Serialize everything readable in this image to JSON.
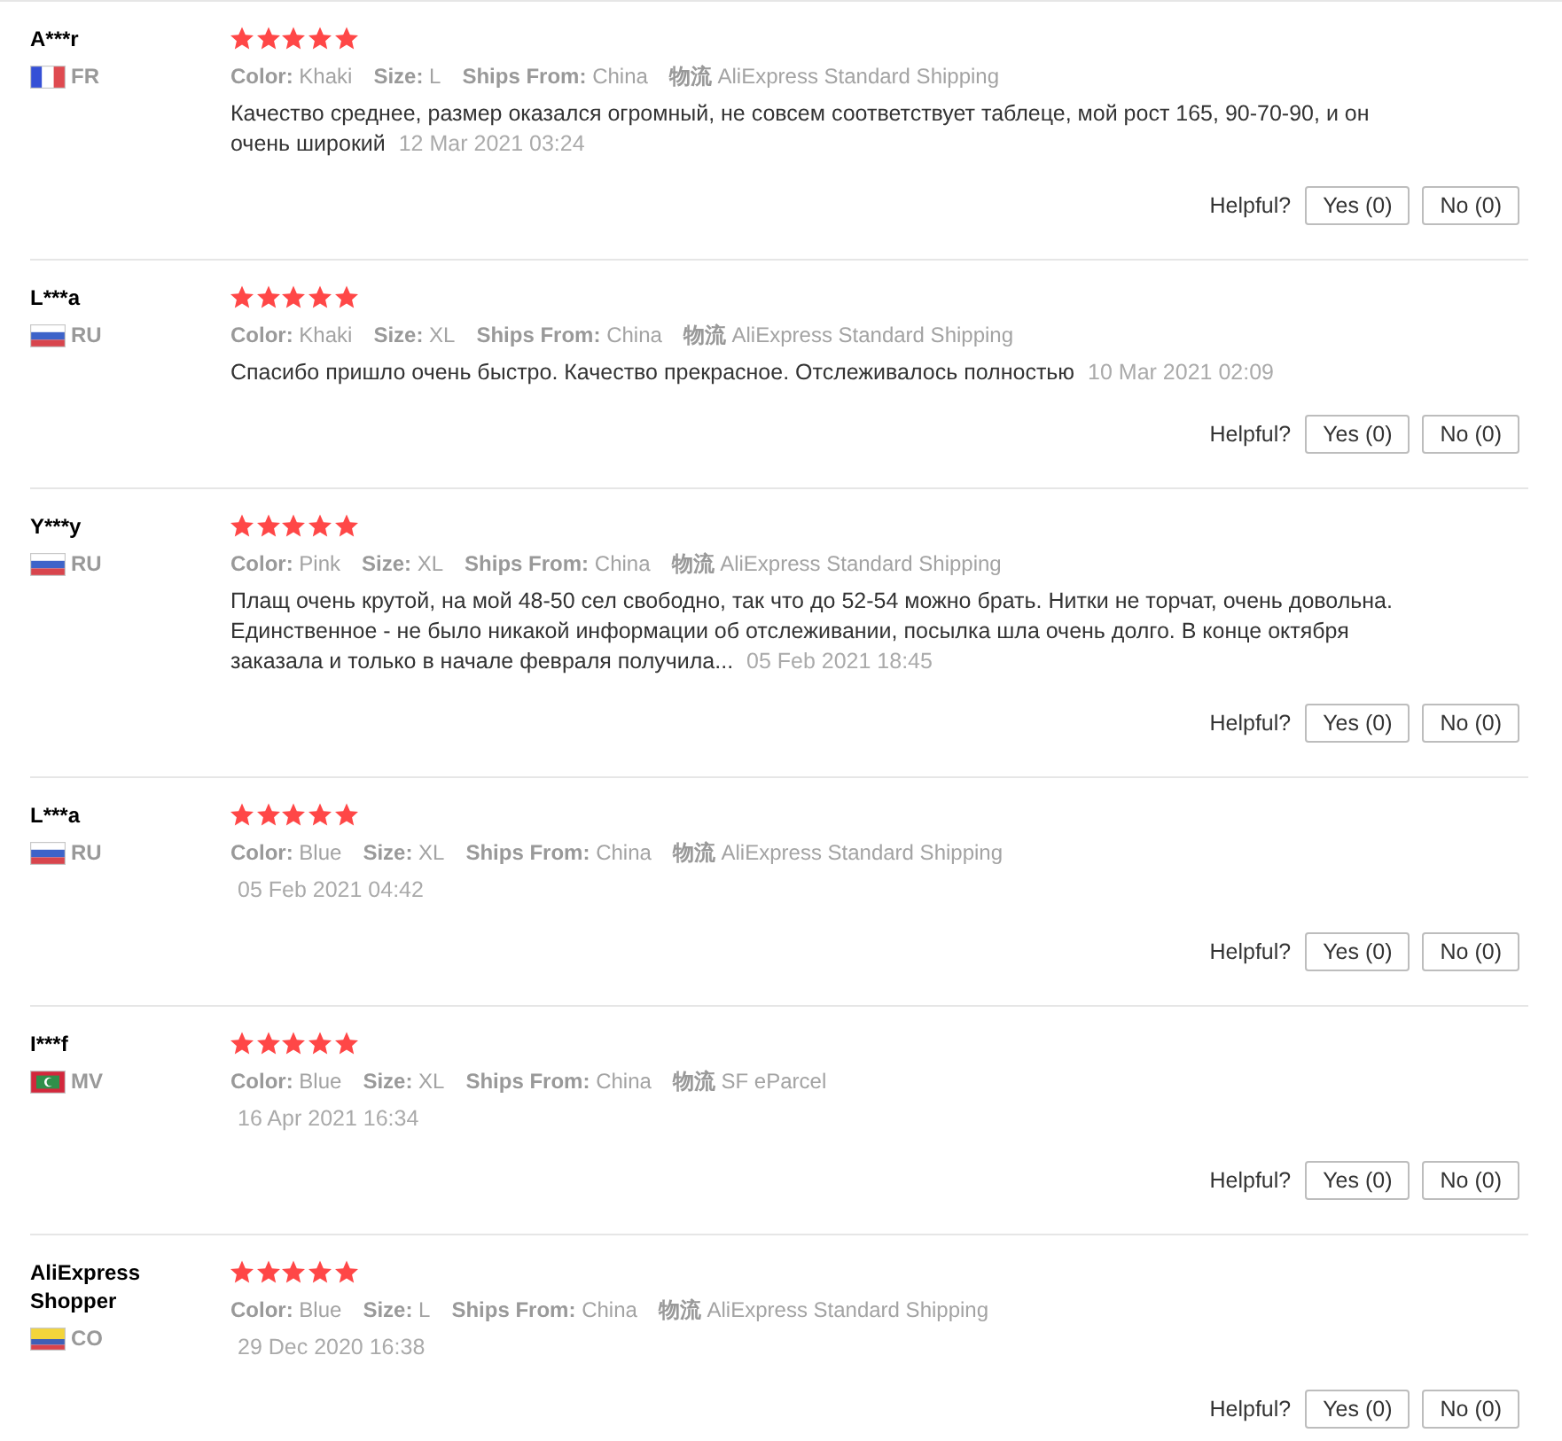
{
  "reviews": [
    {
      "reviewer": "A***r",
      "flag": {
        "kind": "france"
      },
      "country": "FR",
      "stars": 5,
      "attributes": [
        "**Color:** Khaki",
        "**Size:** L",
        "**Ships From:** China",
        "**物流** AliExpress Standard Shipping"
      ],
      "text": "Качество среднее, размер оказался огромный, не совсем соответствует таблеце, мой рост 165, 90-70-90, и он очень широкий",
      "date": "12 Mar 2021 03:24",
      "helpful_label": "Helpful?",
      "yes_button": "Yes (0)",
      "no_button": "No (0)"
    },
    {
      "reviewer": "L***a",
      "flag": {
        "kind": "russia"
      },
      "country": "RU",
      "stars": 5,
      "attributes": [
        "**Color:** Khaki",
        "**Size:** XL",
        "**Ships From:** China",
        "**物流** AliExpress Standard Shipping"
      ],
      "text": "Спасибо пришло очень быстро. Качество прекрасное. Отслеживалось полностью",
      "date": "10 Mar 2021 02:09",
      "helpful_label": "Helpful?",
      "yes_button": "Yes (0)",
      "no_button": "No (0)"
    },
    {
      "reviewer": "Y***y",
      "flag": {
        "kind": "russia"
      },
      "country": "RU",
      "stars": 5,
      "attributes": [
        "**Color:** Pink",
        "**Size:** XL",
        "**Ships From:** China",
        "**物流** AliExpress Standard Shipping"
      ],
      "text": "Плащ очень крутой, на мой 48-50 сел свободно, так что до 52-54 можно брать. Нитки не торчат, очень довольна. Единственное - не было никакой информации об отслеживании, посылка шла очень долго. В конце октября заказала и только в начале февраля получила...",
      "date": "05 Feb 2021 18:45",
      "helpful_label": "Helpful?",
      "yes_button": "Yes (0)",
      "no_button": "No (0)"
    },
    {
      "reviewer": "L***a",
      "flag": {
        "kind": "russia"
      },
      "country": "RU",
      "stars": 5,
      "attributes": [
        "**Color:** Blue",
        "**Size:** XL",
        "**Ships From:** China",
        "**物流** AliExpress Standard Shipping"
      ],
      "date": "05 Feb 2021 04:42",
      "helpful_label": "Helpful?",
      "yes_button": "Yes (0)",
      "no_button": "No (0)"
    },
    {
      "reviewer": "I***f",
      "flag": {
        "kind": "maldives"
      },
      "country": "MV",
      "stars": 5,
      "attributes": [
        "**Color:** Blue",
        "**Size:** XL",
        "**Ships From:** China",
        "**物流** SF eParcel"
      ],
      "date": "16 Apr 2021 16:34",
      "helpful_label": "Helpful?",
      "yes_button": "Yes (0)",
      "no_button": "No (0)"
    },
    {
      "reviewer": "AliExpress Shopper",
      "flag": {
        "kind": "colombia"
      },
      "country": "CO",
      "stars": 5,
      "attributes": [
        "**Color:** Blue",
        "**Size:** L",
        "**Ships From:** China",
        "**物流** AliExpress Standard Shipping"
      ],
      "date": "29 Dec 2020 16:38",
      "helpful_label": "Helpful?",
      "yes_button": "Yes (0)",
      "no_button": "No (0)"
    }
  ]
}
